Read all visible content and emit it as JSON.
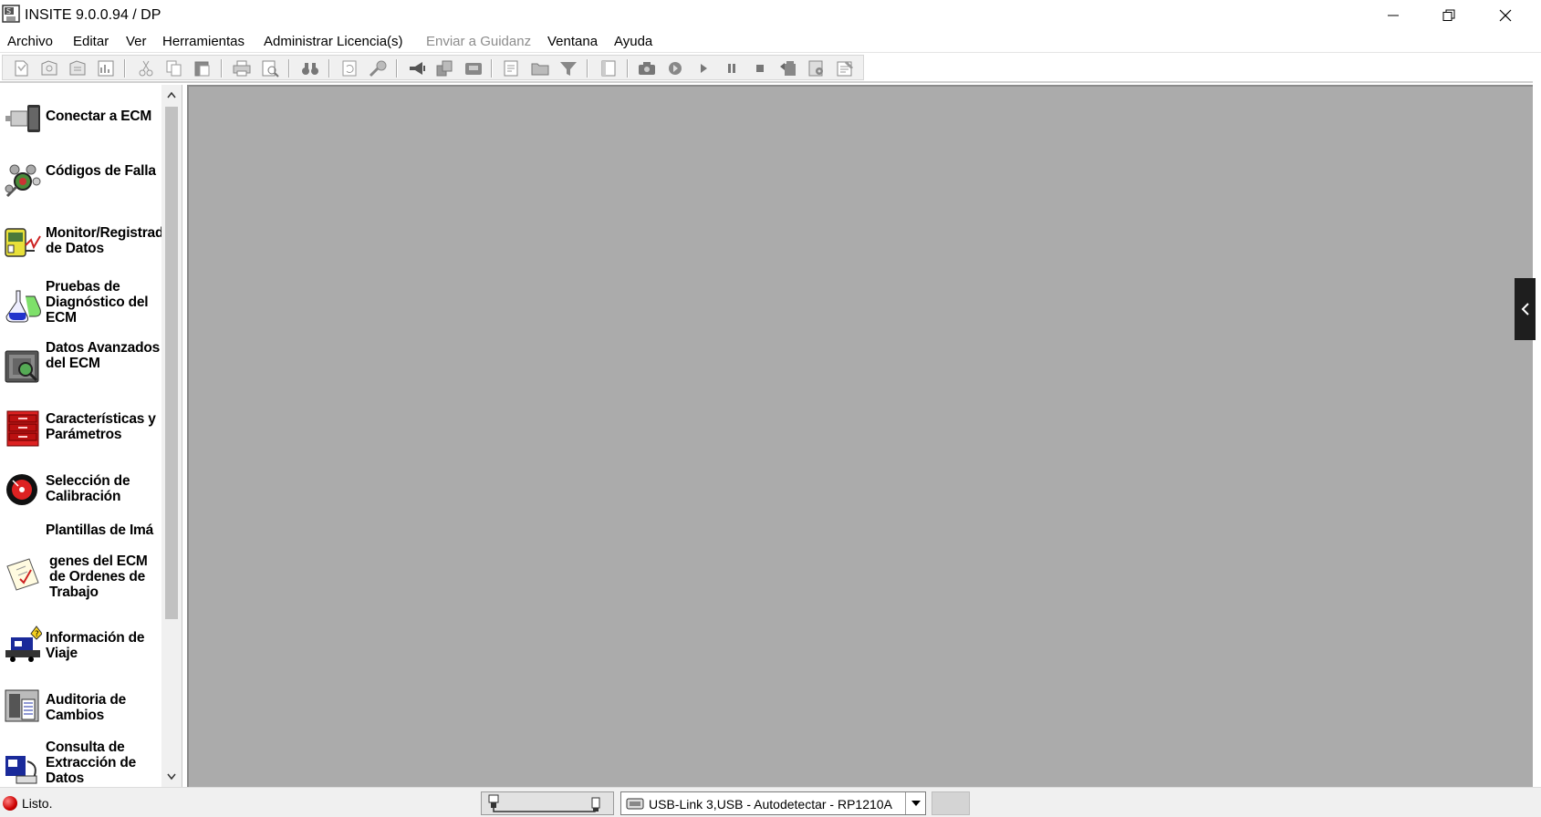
{
  "window": {
    "title": "INSITE 9.0.0.94  / DP",
    "minimize_icon": "minimize-icon",
    "restore_icon": "restore-icon",
    "close_icon": "close-icon"
  },
  "menu": [
    {
      "label": "Archivo",
      "disabled": false
    },
    {
      "label": "Editar",
      "disabled": false
    },
    {
      "label": "Ver",
      "disabled": false
    },
    {
      "label": "Herramientas",
      "disabled": false
    },
    {
      "label": "Administrar Licencia(s)",
      "disabled": false
    },
    {
      "label": "Enviar a Guidanz",
      "disabled": true
    },
    {
      "label": "Ventana",
      "disabled": false
    },
    {
      "label": "Ayuda",
      "disabled": false
    }
  ],
  "toolbar": {
    "buttons": [
      "new-icon",
      "open-icon",
      "save-icon",
      "report-icon",
      "cut-icon",
      "copy-icon",
      "paste-icon",
      "print-icon",
      "print-preview-icon",
      "find-icon",
      "refresh-icon",
      "connect-tool-icon",
      "horn-icon",
      "group-icon",
      "module-icon",
      "document-icon",
      "folder-icon",
      "filter-icon",
      "page-icon",
      "camera-icon",
      "record-icon",
      "play-icon",
      "pause-icon",
      "stop-icon",
      "export-icon",
      "settings-icon",
      "notes-icon"
    ]
  },
  "sidebar": {
    "items": [
      {
        "label": "Conectar a ECM",
        "icon": "connector-icon"
      },
      {
        "label": "Códigos de Falla",
        "icon": "fault-codes-icon"
      },
      {
        "label": "Monitor/Registrador de Datos",
        "icon": "data-monitor-icon"
      },
      {
        "label": "Pruebas de Diagnóstico del ECM",
        "icon": "flask-icon"
      },
      {
        "label": "Datos Avanzados del ECM",
        "icon": "advanced-data-icon"
      },
      {
        "label": "Características y Parámetros",
        "icon": "toolbox-icon"
      },
      {
        "label": "Selección de Calibración",
        "icon": "calibration-disc-icon"
      },
      {
        "label": "Plantillas de Imá",
        "label2": "genes del ECM de Ordenes de Trabajo",
        "icon": "checklist-icon"
      },
      {
        "label": "Información de Viaje",
        "icon": "trip-info-icon"
      },
      {
        "label": "Auditoria de Cambios",
        "icon": "audit-icon"
      },
      {
        "label": "Consulta de Extracción de Datos",
        "icon": "data-extraction-icon"
      }
    ]
  },
  "status": {
    "text": "Listo.",
    "device": "USB-Link 3,USB - Autodetectar - RP1210A"
  }
}
